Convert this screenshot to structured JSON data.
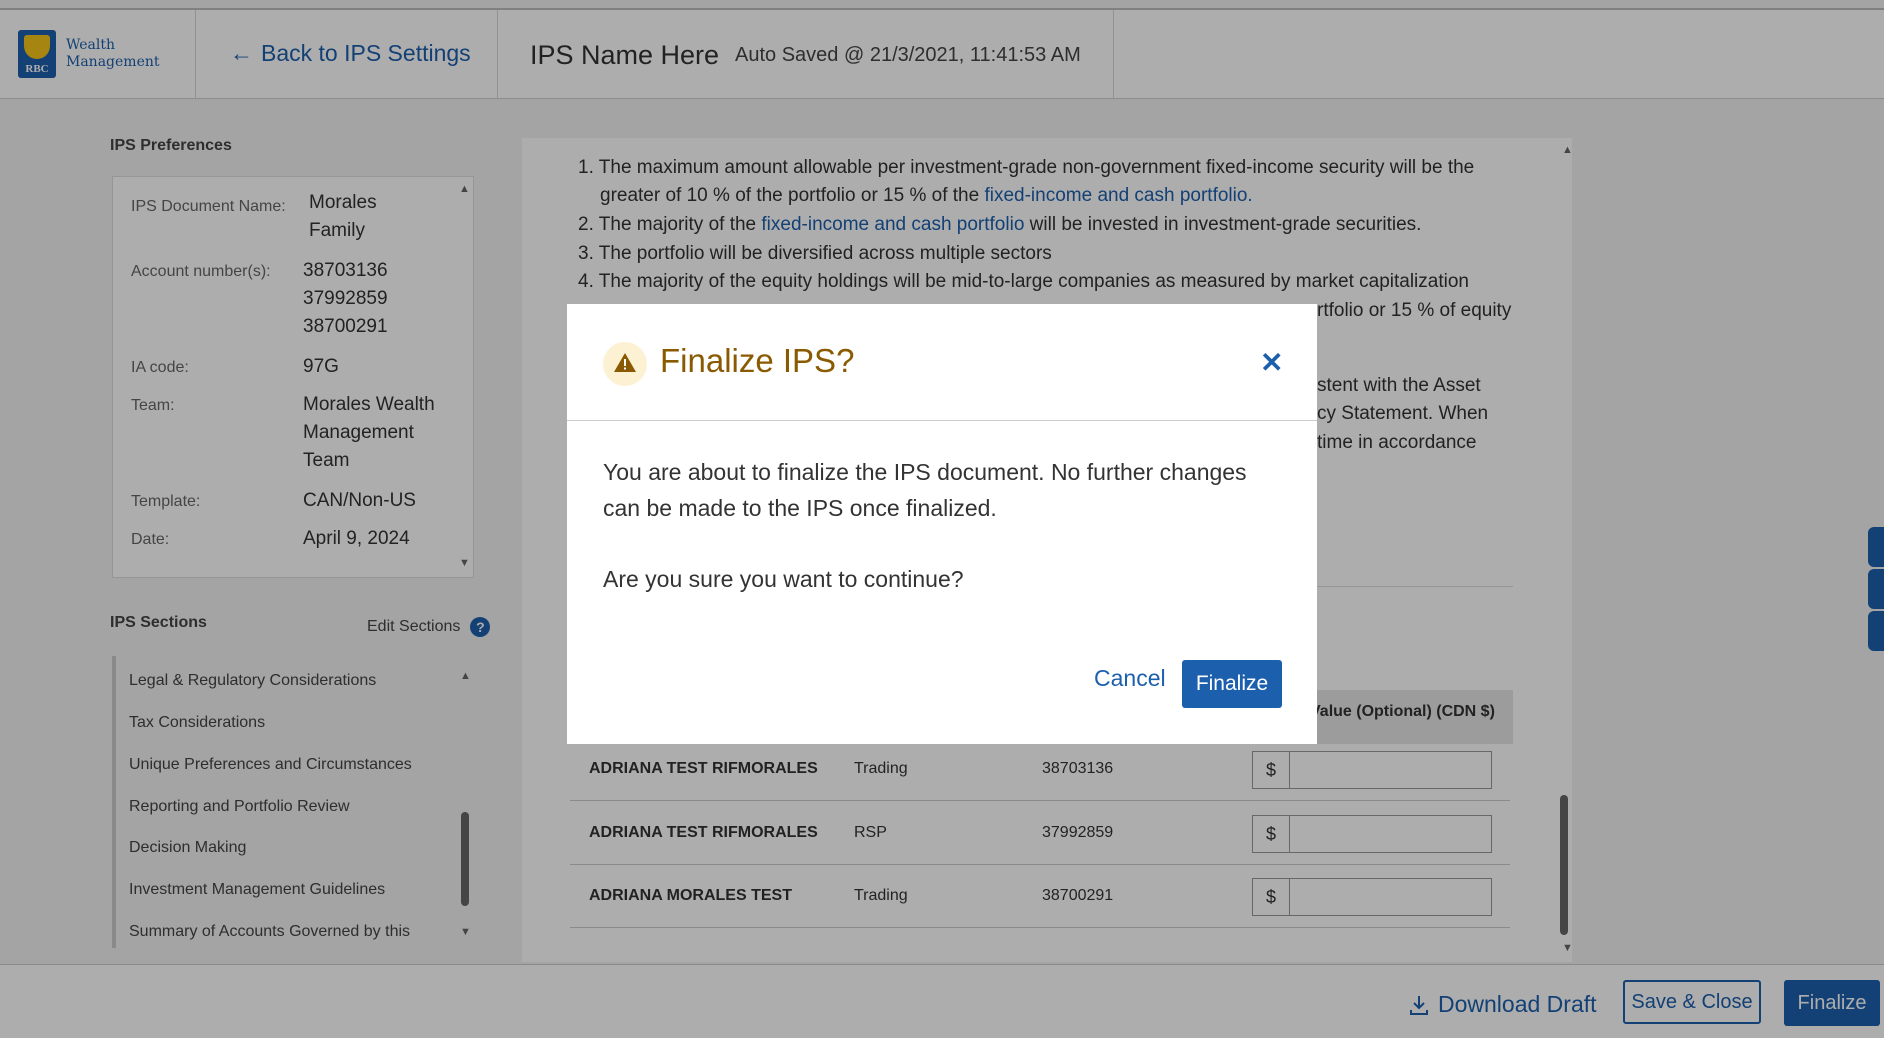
{
  "header": {
    "logo_line1": "Wealth",
    "logo_line2": "Management",
    "logo_mark": "RBC",
    "back_label": "Back to IPS Settings",
    "ips_title": "IPS Name Here",
    "autosave": "Auto Saved @ 21/3/2021, 11:41:53 AM"
  },
  "prefs": {
    "heading": "IPS Preferences",
    "rows": [
      {
        "label": "IPS Document Name:",
        "value": "Morales Family"
      },
      {
        "label": "Account number(s):",
        "value": "38703136 37992859 38700291"
      },
      {
        "label": "IA code:",
        "value": "97G"
      },
      {
        "label": "Team:",
        "value": "Morales Wealth Management Team"
      },
      {
        "label": "Template:",
        "value": "CAN/Non-US"
      },
      {
        "label": "Date:",
        "value": "April 9, 2024"
      }
    ]
  },
  "sections": {
    "heading": "IPS Sections",
    "edit_label": "Edit Sections",
    "items": [
      "Legal & Regulatory Considerations",
      "Tax Considerations",
      "Unique Preferences and Circumstances",
      "Reporting and Portfolio Review",
      "Decision Making",
      "Investment Management Guidelines",
      "Summary of Accounts Governed by this"
    ]
  },
  "content": {
    "item1a": "1. The maximum amount allowable per investment-grade non-government fixed-income security will be the",
    "item1b_pre": "greater of 10 % of the portfolio or 15 % of the ",
    "item1b_link": "fixed-income and cash portfolio.",
    "item2_pre": "2. The majority of the ",
    "item2_link": "fixed-income and cash portfolio",
    "item2_post": " will be invested in investment-grade securities.",
    "item3": "3. The portfolio will be diversified across multiple sectors",
    "item4": "4. The majority of the equity holdings will be mid-to-large companies as measured by market capitalization",
    "item5_tail": "rtfolio or 15 % of equity",
    "para_tail1": "stent with the Asset",
    "para_tail2": "cy Statement. When",
    "para_tail3": "time in accordance"
  },
  "table": {
    "value_header": "Value (Optional) (CDN $)",
    "currency": "$",
    "rows": [
      {
        "name": "ADRIANA TEST RIFMORALES",
        "type": "Trading",
        "account": "38703136"
      },
      {
        "name": "ADRIANA TEST RIFMORALES",
        "type": "RSP",
        "account": "37992859"
      },
      {
        "name": "ADRIANA MORALES TEST",
        "type": "Trading",
        "account": "38700291"
      }
    ]
  },
  "footer": {
    "download": "Download Draft",
    "save_close": "Save & Close",
    "finalize": "Finalize"
  },
  "modal": {
    "title": "Finalize IPS?",
    "body": "You are about to finalize the IPS document. No further changes can be made to the IPS once finalized.",
    "question": "Are you sure you want to continue?",
    "cancel": "Cancel",
    "confirm": "Finalize",
    "close_glyph": "✕"
  },
  "colors": {
    "brand": "#1c5fad",
    "warning": "#8a5a00"
  }
}
